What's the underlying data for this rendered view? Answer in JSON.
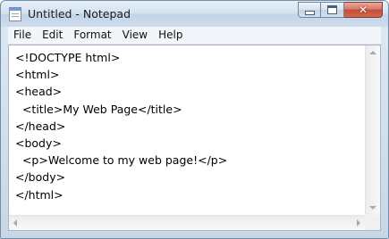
{
  "window": {
    "title": "Untitled - Notepad",
    "icon": "notepad-icon"
  },
  "caption_buttons": {
    "minimize_icon": "minimize-icon",
    "maximize_icon": "maximize-icon",
    "close_icon": "close-icon",
    "close_glyph": "✕"
  },
  "menu": {
    "items": [
      "File",
      "Edit",
      "Format",
      "View",
      "Help"
    ]
  },
  "editor": {
    "lines": [
      "<!DOCTYPE html>",
      "<html>",
      "<head>",
      "  <title>My Web Page</title>",
      "</head>",
      "<body>",
      "  <p>Welcome to my web page!</p>",
      "</body>",
      "</html>"
    ]
  },
  "colors": {
    "close_button": "#c44d38",
    "title_bar": "#d3e1ee"
  }
}
